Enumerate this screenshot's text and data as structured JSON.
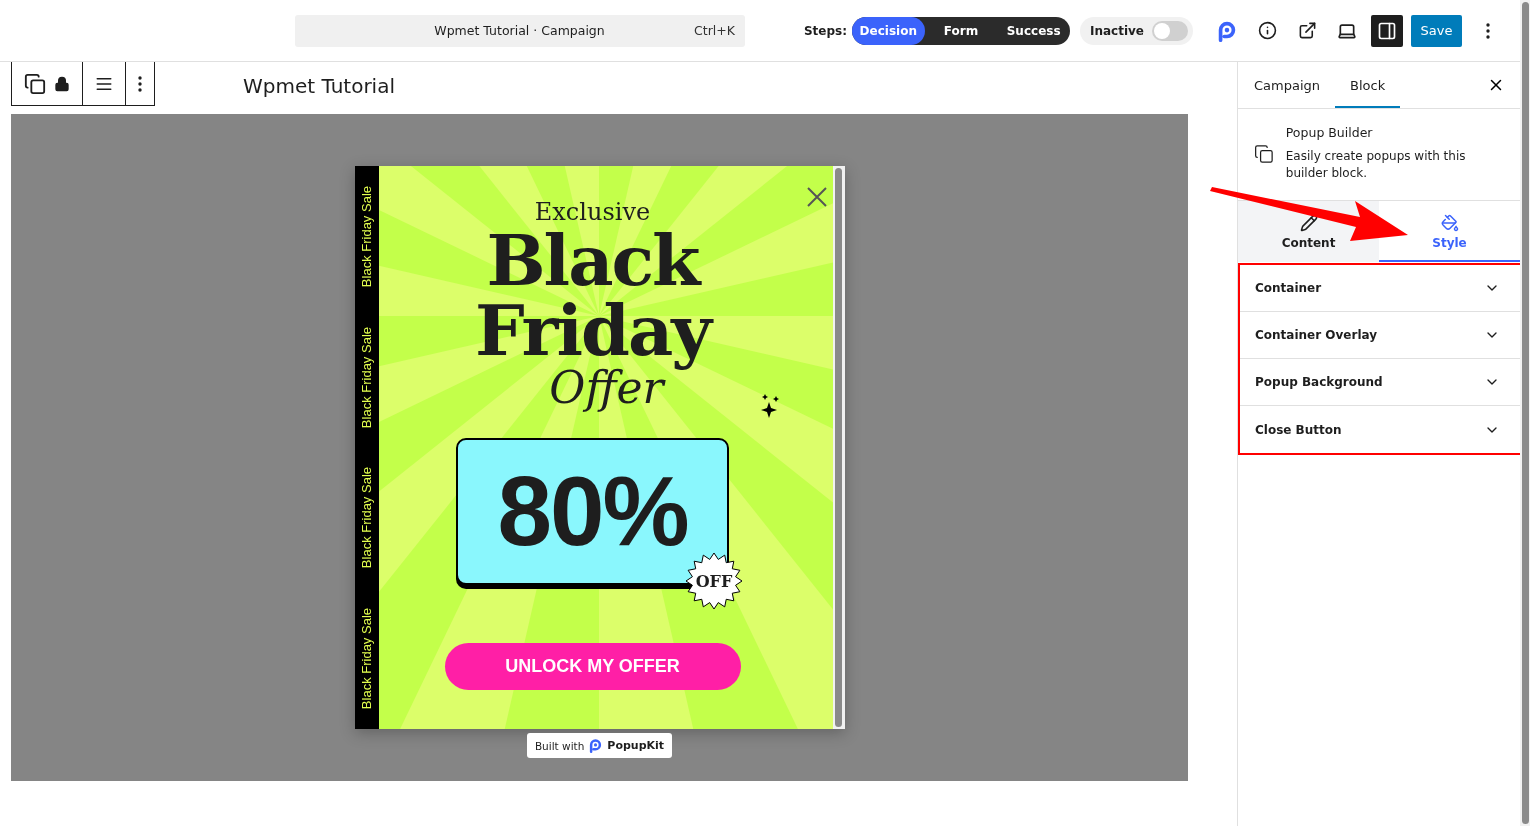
{
  "header": {
    "search": {
      "title": "Wpmet Tutorial · Campaign",
      "shortcut": "Ctrl+K"
    },
    "steps_label": "Steps:",
    "steps": [
      {
        "label": "Decision",
        "selected": true
      },
      {
        "label": "Form",
        "selected": false
      },
      {
        "label": "Success",
        "selected": false
      }
    ],
    "status": {
      "label": "Inactive",
      "on": false
    },
    "save": "Save"
  },
  "page_title": "Wpmet Tutorial",
  "popup": {
    "side_strip": [
      "Black Friday Sale",
      "Black Friday Sale",
      "Black Friday Sale",
      "Black Friday Sale"
    ],
    "eyebrow": "Exclusive",
    "headline": [
      "Black",
      "Friday"
    ],
    "script": "Offer",
    "discount": "80%",
    "badge": "OFF",
    "cta": "UNLOCK MY OFFER",
    "credit": {
      "prefix": "Built with",
      "brand": "PopupKit"
    }
  },
  "sidebar": {
    "tabs": [
      {
        "label": "Campaign",
        "selected": false
      },
      {
        "label": "Block",
        "selected": true
      }
    ],
    "block": {
      "title": "Popup Builder",
      "description": "Easily create popups with this builder block."
    },
    "mode_tabs": [
      {
        "label": "Content",
        "selected": false,
        "kind": "pencil"
      },
      {
        "label": "Style",
        "selected": true,
        "kind": "paint"
      }
    ],
    "sections": [
      {
        "label": "Container",
        "expanded": false
      },
      {
        "label": "Container Overlay",
        "expanded": false
      },
      {
        "label": "Popup Background",
        "expanded": false
      },
      {
        "label": "Close Button",
        "expanded": false
      }
    ]
  }
}
